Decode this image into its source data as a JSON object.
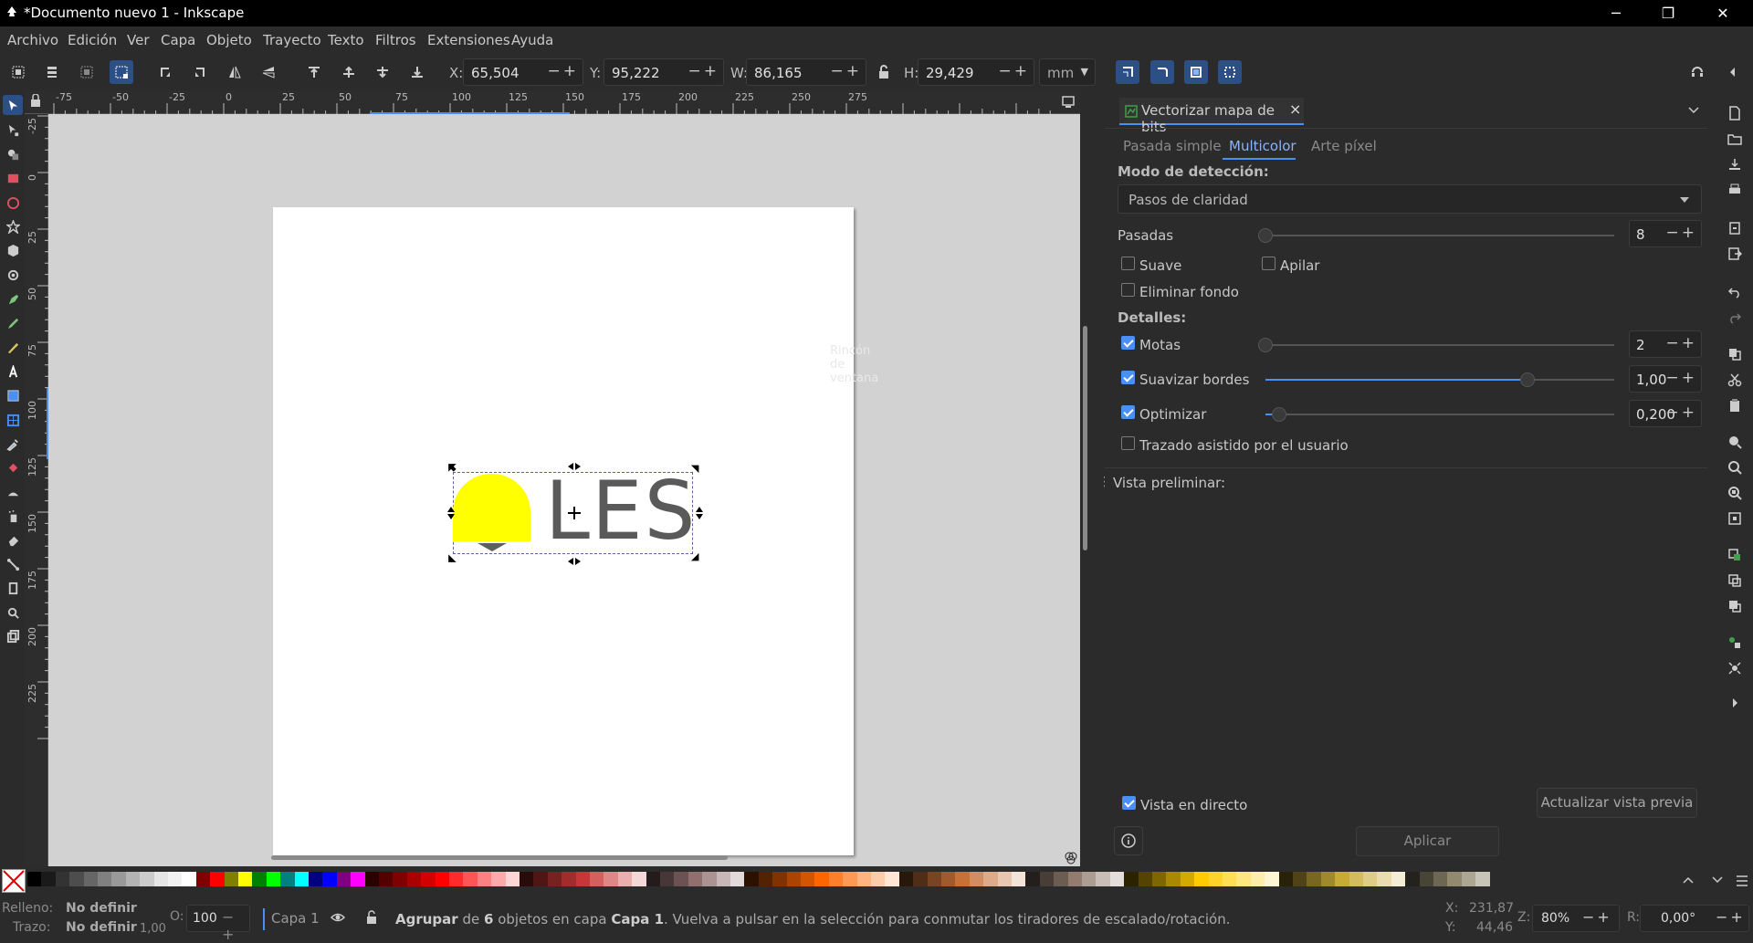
{
  "window": {
    "title": "*Documento nuevo 1 - Inkscape",
    "minimize": "─",
    "maximize": "❐",
    "close": "✕"
  },
  "menu": [
    "Archivo",
    "Edición",
    "Ver",
    "Capa",
    "Objeto",
    "Trayecto",
    "Texto",
    "Filtros",
    "Extensiones",
    "Ayuda"
  ],
  "toolbar": {
    "x_label": "X:",
    "x_value": "65,504",
    "y_label": "Y:",
    "y_value": "95,222",
    "w_label": "W:",
    "w_value": "86,165",
    "h_label": "H:",
    "h_value": "29,429",
    "unit": "mm",
    "spin_pm": "−+"
  },
  "ruler": {
    "h_ticks": [
      "-75",
      "-50",
      "-25",
      "0",
      "25",
      "50",
      "75",
      "100",
      "125",
      "150",
      "175",
      "200",
      "225",
      "250",
      "275"
    ],
    "v_ticks": [
      "-25",
      "0",
      "25",
      "50",
      "75",
      "100",
      "125",
      "150",
      "175",
      "200",
      "225"
    ]
  },
  "canvas": {
    "logo_text": "LES",
    "watermark": "Rincón de ventana"
  },
  "dock": {
    "tab_title": "Vectorizar mapa de bits",
    "tab_close": "×",
    "subtabs": [
      "Pasada simple",
      "Multicolor",
      "Arte píxel"
    ],
    "active_subtab": "Multicolor",
    "mode_label": "Modo de detección:",
    "mode_value": "Pasos de claridad",
    "passes_label": "Pasadas",
    "passes_value": "8",
    "smooth_label": "Suave",
    "smooth_checked": false,
    "stack_label": "Apilar",
    "stack_checked": false,
    "remove_bg_label": "Eliminar fondo",
    "remove_bg_checked": false,
    "details_label": "Detalles:",
    "speckles_label": "Motas",
    "speckles_checked": true,
    "speckles_value": "2",
    "speckles_level": 0,
    "smooth_corners_label": "Suavizar bordes",
    "smooth_corners_checked": true,
    "smooth_corners_value": "1,00",
    "smooth_corners_level": 0.75,
    "optimize_label": "Optimizar",
    "optimize_checked": true,
    "optimize_value": "0,200",
    "optimize_level": 0.04,
    "user_trace_label": "Trazado asistido por el usuario",
    "user_trace_checked": false,
    "preview_label": "Vista preliminar:",
    "live_preview_label": "Vista en directo",
    "live_preview_checked": true,
    "update_preview_button": "Actualizar vista previa",
    "apply_button": "Aplicar"
  },
  "palette": {
    "none_label": "✕",
    "colors": [
      "#000000",
      "#1a1a1a",
      "#333333",
      "#4d4d4d",
      "#666666",
      "#808080",
      "#999999",
      "#b3b3b3",
      "#cccccc",
      "#e6e6e6",
      "#f2f2f2",
      "#ffffff",
      "#800000",
      "#ff0000",
      "#808000",
      "#ffff00",
      "#008000",
      "#00ff00",
      "#008080",
      "#00ffff",
      "#000080",
      "#0000ff",
      "#800080",
      "#ff00ff",
      "#2b0000",
      "#550000",
      "#800000",
      "#aa0000",
      "#d40000",
      "#ff0000",
      "#ff2a2a",
      "#ff5555",
      "#ff8080",
      "#ffaaaa",
      "#ffd5d5",
      "#280b0b",
      "#501616",
      "#782121",
      "#a02c2c",
      "#c83737",
      "#d35f5f",
      "#de8787",
      "#e9afaf",
      "#f4d7d7",
      "#241c1c",
      "#483737",
      "#6c5353",
      "#916f6f",
      "#ac9393",
      "#c8b7b7",
      "#e3dbdb",
      "#2b1100",
      "#552200",
      "#803300",
      "#aa4400",
      "#d45500",
      "#ff6600",
      "#ff7f2a",
      "#ff9955",
      "#ffb380",
      "#ffccaa",
      "#ffe6d5",
      "#28170b",
      "#502d16",
      "#784421",
      "#a05a2c",
      "#c87137",
      "#d38d5f",
      "#deaa87",
      "#e9c6af",
      "#f4e3d7",
      "#241f1c",
      "#483e37",
      "#6c5d53",
      "#917c6f",
      "#ac9d93",
      "#c8beb7",
      "#e3dedb",
      "#2b2200",
      "#554400",
      "#806600",
      "#aa8800",
      "#d4aa00",
      "#ffcc00",
      "#ffd42a",
      "#ffdd55",
      "#ffe680",
      "#ffeeaa",
      "#fff6d5",
      "#28220b",
      "#504416",
      "#786721",
      "#a0892c",
      "#c8ab37",
      "#d3bc5f",
      "#decd87",
      "#e9ddaf",
      "#f4eed7",
      "#24221c",
      "#484537",
      "#6c6753",
      "#918a6f",
      "#aca793",
      "#c8c4b7"
    ]
  },
  "status": {
    "fill_label": "Relleno:",
    "fill_value": "No definir",
    "stroke_label": "Trazo:",
    "stroke_value": "No definir",
    "stroke_width": "1,00",
    "opacity_label": "O:",
    "opacity_value": "100",
    "layer": "Capa 1",
    "message_bold1": "Agrupar",
    "message_part1": " de ",
    "message_bold2": "6",
    "message_part2": " objetos en capa ",
    "message_bold3": "Capa 1",
    "message_part3": ". Vuelva a pulsar en la selección para conmutar los tiradores de escalado/rotación.",
    "cursor_x_label": "X:",
    "cursor_x": "231,87",
    "cursor_y_label": "Y:",
    "cursor_y": "44,46",
    "zoom_label": "Z:",
    "zoom": "80%",
    "rotation_label": "R:",
    "rotation": "0,00°"
  }
}
